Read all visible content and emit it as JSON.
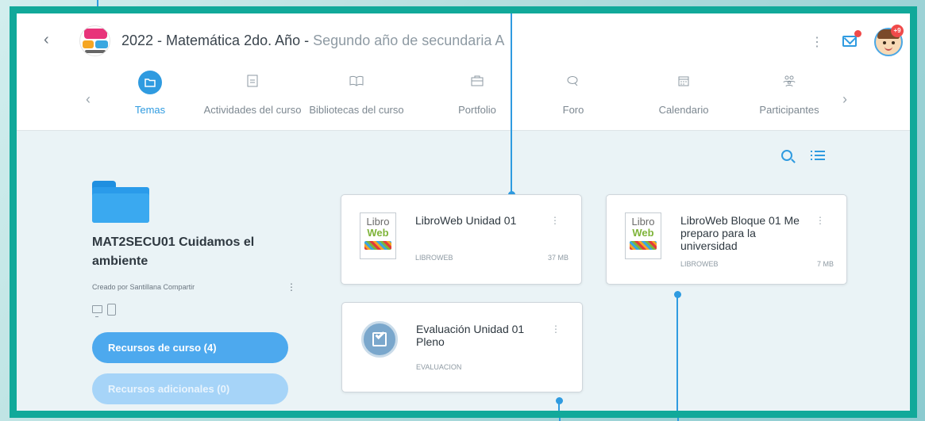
{
  "header": {
    "course_name": "2022 - Matemática 2do. Año - ",
    "course_section": "Segundo año de secundaria A",
    "avatar_badge": "+9"
  },
  "tabs": [
    {
      "label": "Temas",
      "icon": "folder-icon",
      "active": true
    },
    {
      "label": "Actividades del curso",
      "icon": "activities-icon",
      "active": false
    },
    {
      "label": "Bibliotecas del curso",
      "icon": "book-icon",
      "active": false
    },
    {
      "label": "Portfolio",
      "icon": "briefcase-icon",
      "active": false
    },
    {
      "label": "Foro",
      "icon": "chat-icon",
      "active": false
    },
    {
      "label": "Calendario",
      "icon": "calendar-icon",
      "active": false
    },
    {
      "label": "Participantes",
      "icon": "participants-icon",
      "active": false
    }
  ],
  "unit": {
    "title": "MAT2SECU01 Cuidamos el ambiente",
    "creator": "Creado por Santillana Compartir",
    "course_resources_label": "Recursos de curso (4)",
    "additional_resources_label": "Recursos adicionales (0)"
  },
  "resources": [
    {
      "title": "LibroWeb Unidad 01",
      "type": "LIBROWEB",
      "size": "37 MB",
      "icon": "libroweb-logo"
    },
    {
      "title": "LibroWeb Bloque 01 Me preparo para la universidad",
      "type": "LIBROWEB",
      "size": "7 MB",
      "icon": "libroweb-logo"
    },
    {
      "title": "Evaluación Unidad 01 Pleno",
      "type": "EVALUACION",
      "size": "",
      "icon": "evaluation-check-icon"
    }
  ],
  "libro_logo": {
    "line1": "Libro",
    "line2": "Web"
  },
  "colors": {
    "accent": "#2f9be0",
    "frame": "#11a99a",
    "primary_button": "#4da9ee",
    "disabled_button": "#a6d4f8"
  }
}
